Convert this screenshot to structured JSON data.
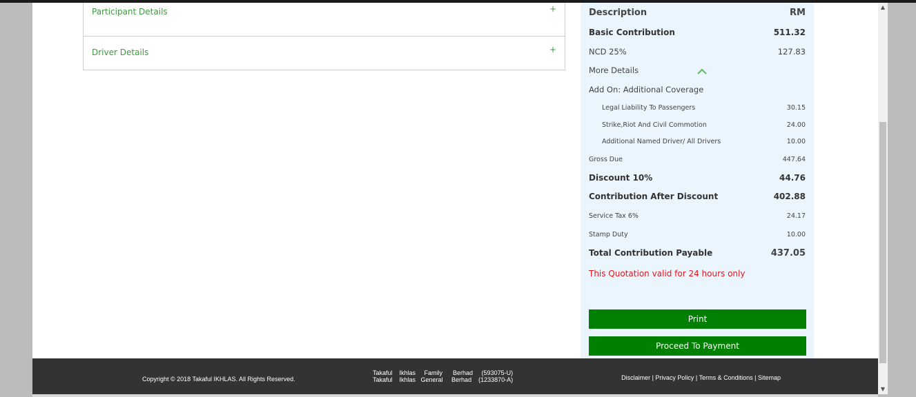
{
  "accordion": {
    "participant_label": "Participant Details",
    "driver_label": "Driver Details",
    "expand_symbol": "+"
  },
  "summary": {
    "header_desc": "Description",
    "header_unit": "RM",
    "basic_label": "Basic Contribution",
    "basic_value": "511.32",
    "ncd_label": "NCD 25%",
    "ncd_value": "127.83",
    "more_details": "More Details",
    "addon_label": "Add On: Additional Coverage",
    "addons": [
      {
        "label": "Legal Liability To Passengers",
        "value": "30.15"
      },
      {
        "label": "Strike,Riot And Civil Commotion",
        "value": "24.00"
      },
      {
        "label": "Additional Named Driver/ All Drivers",
        "value": "10.00"
      }
    ],
    "gross_label": "Gross Due",
    "gross_value": "447.64",
    "discount_label": "Discount 10%",
    "discount_value": "44.76",
    "after_discount_label": "Contribution After Discount",
    "after_discount_value": "402.88",
    "tax_label": "Service Tax 6%",
    "tax_value": "24.17",
    "stamp_label": "Stamp Duty",
    "stamp_value": "10.00",
    "total_label": "Total Contribution Payable",
    "total_value": "437.05",
    "validity_note": "This Quotation valid for 24 hours only",
    "print_button": "Print",
    "proceed_button": "Proceed To Payment"
  },
  "footer": {
    "copyright": "Copyright © 2018 Takaful IKHLAS. All Rights Reserved.",
    "company_line1": "Takaful    Ikhlas     Family      Berhad     (593075-U)",
    "company_line2": "Takaful    Ikhlas   General     Berhad    (1233870-A)",
    "links": "Disclaimer | Privacy Policy | Terms & Conditions | Sitemap"
  },
  "colors": {
    "accent_green": "#008000",
    "label_green": "#3d9a3d",
    "warning_red": "#e3151a",
    "panel_bg": "#eaf5fd",
    "footer_bg": "#333333"
  },
  "icons": [
    "plus-icon",
    "chevron-up-icon",
    "scroll-up-arrow-icon",
    "scroll-down-arrow-icon"
  ]
}
